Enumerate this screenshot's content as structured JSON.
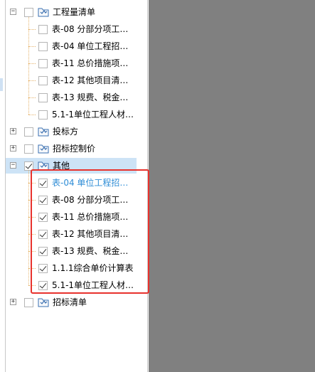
{
  "tree": {
    "groups": [
      {
        "label": "工程量清单",
        "expanded": true,
        "checked": false,
        "children": [
          {
            "label": "表-08 分部分项工…",
            "checked": false
          },
          {
            "label": "表-04 单位工程招…",
            "checked": false
          },
          {
            "label": "表-11 总价措施项…",
            "checked": false
          },
          {
            "label": "表-12 其他项目清…",
            "checked": false
          },
          {
            "label": "表-13 规费、税金…",
            "checked": false
          },
          {
            "label": "5.1-1单位工程人材…",
            "checked": false
          }
        ]
      },
      {
        "label": "投标方",
        "expanded": false,
        "checked": false,
        "children": []
      },
      {
        "label": "招标控制价",
        "expanded": false,
        "checked": false,
        "children": []
      },
      {
        "label": "其他",
        "expanded": true,
        "checked": true,
        "selected": true,
        "children": [
          {
            "label": "表-04 单位工程招…",
            "checked": true,
            "highlight": true
          },
          {
            "label": "表-08 分部分项工…",
            "checked": true
          },
          {
            "label": "表-11 总价措施项…",
            "checked": true
          },
          {
            "label": "表-12 其他项目清…",
            "checked": true
          },
          {
            "label": "表-13 规费、税金…",
            "checked": true
          },
          {
            "label": "1.1.1综合单价计算表",
            "checked": true
          },
          {
            "label": "5.1-1单位工程人材…",
            "checked": true
          }
        ]
      },
      {
        "label": "招标清单",
        "expanded": false,
        "checked": false,
        "children": []
      }
    ]
  },
  "expander_symbols": {
    "expanded": "−",
    "collapsed": "+"
  },
  "icons": {
    "group": "report-folder-icon",
    "expander": "expander-box-icon"
  },
  "colors": {
    "highlight_text": "#2f8dd6",
    "selection": "#cde3f6",
    "annotation_box": "#e8322d",
    "tree_lines": "#e6b36b",
    "viewer_background": "#808080"
  }
}
